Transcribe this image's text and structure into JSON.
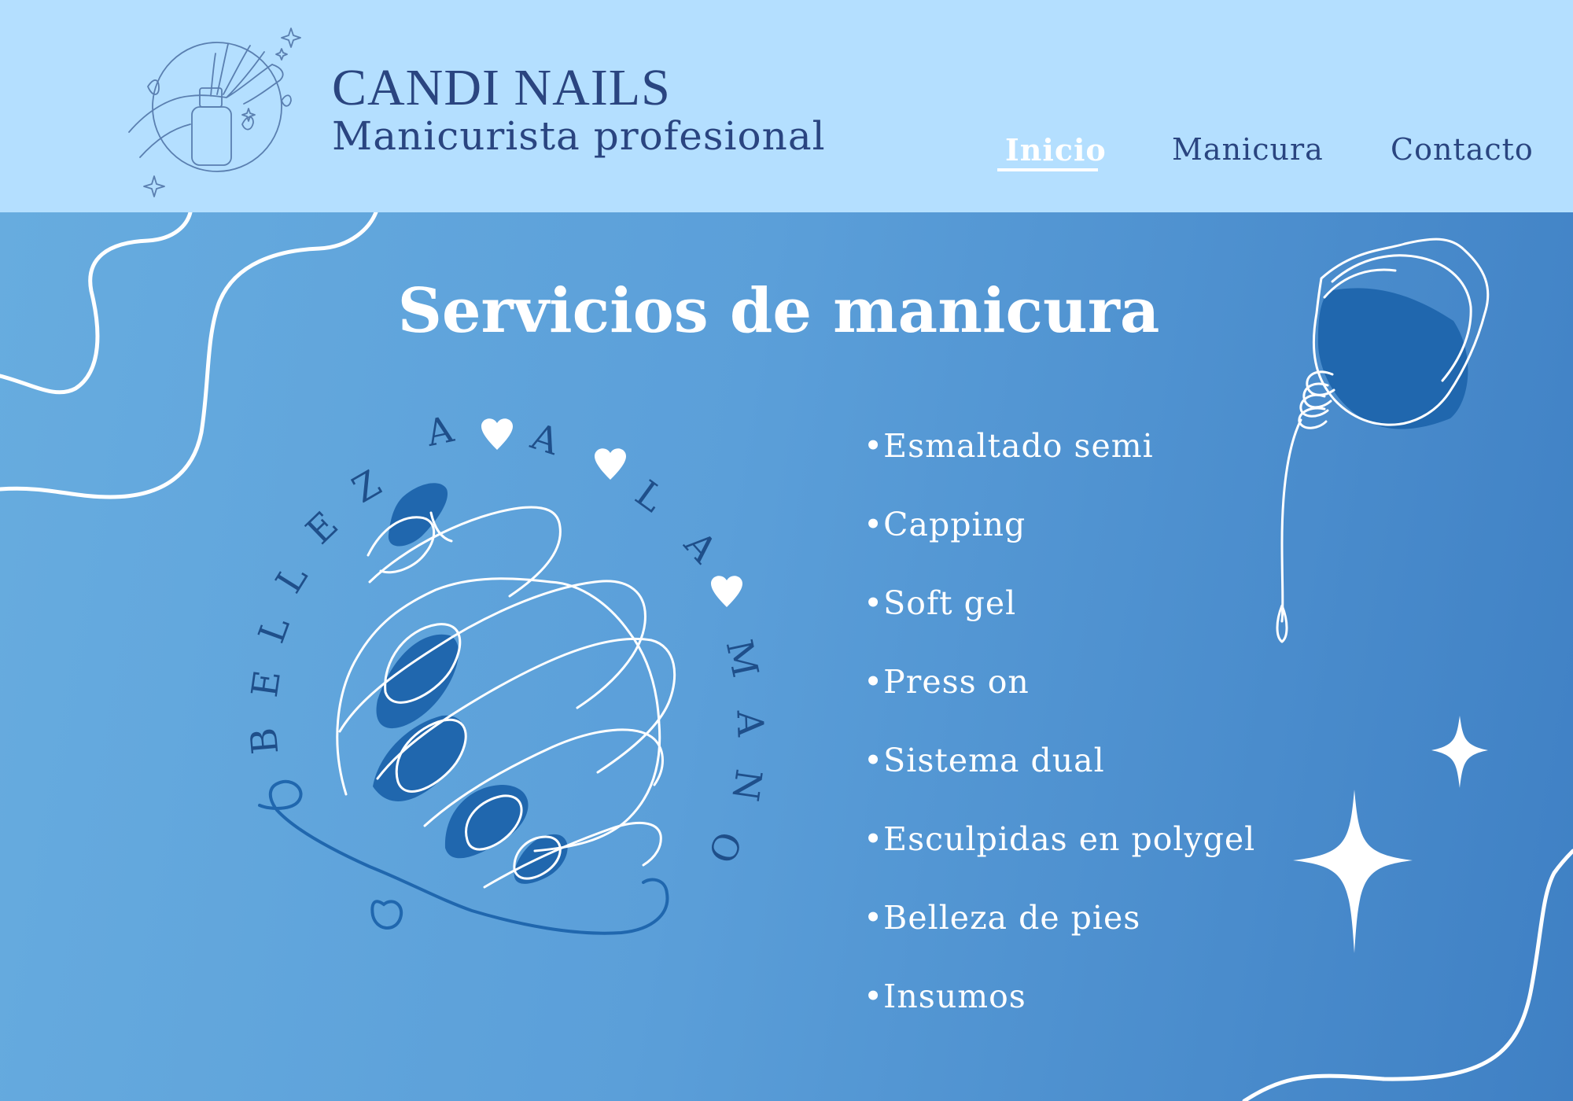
{
  "brand": {
    "name": "CANDI NAILS",
    "tagline": "Manicurista profesional"
  },
  "nav": {
    "items": [
      {
        "label": "Inicio",
        "active": true
      },
      {
        "label": "Manicura",
        "active": false
      },
      {
        "label": "Contacto",
        "active": false
      }
    ]
  },
  "hero": {
    "title": "Servicios de manicura",
    "curved_text": "BELLEZA A LA MANO"
  },
  "services": [
    "•Esmaltado semi",
    "•Capping",
    "•Soft gel",
    "•Press on",
    "•Sistema dual",
    "•Esculpidas en polygel",
    "•Belleza de pies",
    "•Insumos"
  ],
  "colors": {
    "header_bg": "#b4dfff",
    "brand_text": "#2a4580",
    "hero_gradient_start": "#67acdf",
    "hero_gradient_end": "#3f80c4",
    "accent_dark": "#1f63a8",
    "white": "#ffffff"
  }
}
